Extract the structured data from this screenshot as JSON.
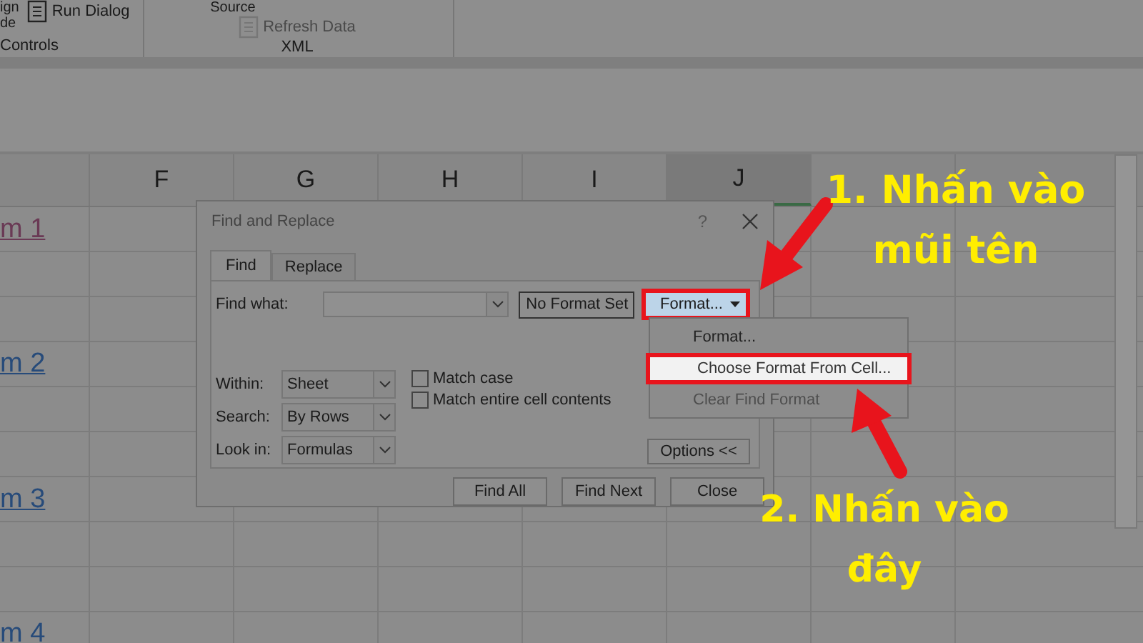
{
  "ribbon": {
    "groups": [
      {
        "label": "Controls",
        "stacked": [
          "ign",
          "de"
        ],
        "buttons": [
          {
            "label": "Run Dialog",
            "disabled": false
          }
        ]
      },
      {
        "label": "XML",
        "stacked": [
          "Source"
        ],
        "buttons": [
          {
            "label": "Refresh Data",
            "disabled": true
          }
        ]
      }
    ]
  },
  "sheet": {
    "columns": [
      {
        "selected": false
      },
      {
        "label": "F",
        "selected": false
      },
      {
        "label": "G",
        "selected": false
      },
      {
        "label": "H",
        "selected": false
      },
      {
        "label": "I",
        "selected": false
      },
      {
        "label": "J",
        "selected": true
      },
      {
        "selected": false
      },
      {
        "selected": false
      }
    ],
    "rows": [
      {
        "link": "m 1",
        "visited": true
      },
      {},
      {},
      {
        "link": "m 2",
        "visited": false
      },
      {},
      {},
      {
        "link": "m 3",
        "visited": false
      },
      {},
      {},
      {
        "link": "m 4",
        "visited": false
      }
    ]
  },
  "dialog": {
    "title": "Find and Replace",
    "help": "?",
    "tabs": [
      {
        "label": "Find",
        "selected": true
      },
      {
        "label": "Replace",
        "selected": false
      }
    ],
    "find_what": {
      "label": "Find what:"
    },
    "no_format": "No Format Set",
    "format_button": "Format...",
    "selects": [
      {
        "label": "Within:",
        "value": "Sheet"
      },
      {
        "label": "Search:",
        "value": "By Rows"
      },
      {
        "label": "Look in:",
        "value": "Formulas"
      }
    ],
    "checkboxes": [
      {
        "label": "Match case",
        "checked": false
      },
      {
        "label": "Match entire cell contents",
        "checked": false
      }
    ],
    "options_button": "Options <<",
    "buttons": [
      "Find All",
      "Find Next",
      "Close"
    ]
  },
  "format_menu": [
    {
      "label": "Format...",
      "selected": false,
      "disabled": false
    },
    {
      "label": "Choose Format From Cell...",
      "selected": true,
      "disabled": false
    },
    {
      "label": "Clear Find Format",
      "selected": false,
      "disabled": true
    }
  ],
  "annotations": [
    {
      "text": "1. Nhấn vào mũi tên"
    },
    {
      "text": "2. Nhấn vào đây"
    }
  ]
}
